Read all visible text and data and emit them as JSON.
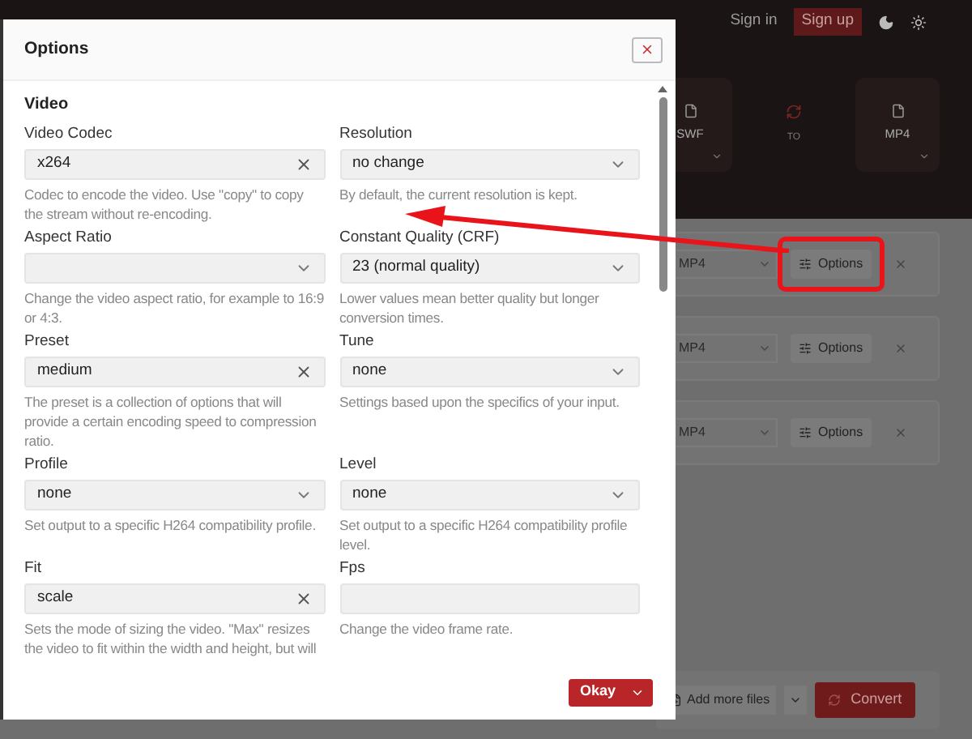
{
  "page": {
    "sign_in": "Sign in",
    "sign_up": "Sign up",
    "formats": [
      {
        "kind": "file",
        "label": "SWF"
      },
      {
        "kind": "convert",
        "label": "TO"
      },
      {
        "kind": "file",
        "label": "MP4"
      }
    ],
    "rows": [
      {
        "format": "MP4",
        "options": "Options",
        "highlighted": true
      },
      {
        "format": "MP4",
        "options": "Options",
        "highlighted": false
      },
      {
        "format": "MP4",
        "options": "Options",
        "highlighted": false
      }
    ],
    "add_more": "Add more files",
    "convert": "Convert"
  },
  "dialog": {
    "title": "Options",
    "section": "Video",
    "fields": [
      {
        "label": "Video Codec",
        "kind": "clearable",
        "value": "x264",
        "help": "Codec to encode the video. Use \"copy\" to copy the stream without re-encoding."
      },
      {
        "label": "Resolution",
        "kind": "select",
        "value": "no change",
        "help": "By default, the current resolution is kept."
      },
      {
        "label": "Aspect Ratio",
        "kind": "select",
        "help": "Change the video aspect ratio, for example to 16:9 or 4:3."
      },
      {
        "label": "Constant Quality (CRF)",
        "kind": "select",
        "value": "23 (normal quality)",
        "help": "Lower values mean better quality but longer conversion times."
      },
      {
        "label": "Preset",
        "kind": "clearable",
        "value": "medium",
        "help": "The preset is a collection of options that will provide a certain encoding speed to compression ratio."
      },
      {
        "label": "Tune",
        "kind": "select",
        "value": "none",
        "help": "Settings based upon the specifics of your input."
      },
      {
        "label": "Profile",
        "kind": "select",
        "value": "none",
        "help": "Set output to a specific H264 compatibility profile."
      },
      {
        "label": "Level",
        "kind": "select",
        "value": "none",
        "help": "Set output to a specific H264 compatibility profile level."
      },
      {
        "label": "Fit",
        "kind": "clearable",
        "value": "scale",
        "help": "Sets the mode of sizing the video. \"Max\" resizes the video to fit within the width and height, but will"
      },
      {
        "label": "Fps",
        "kind": "text",
        "help": "Change the video frame rate."
      }
    ],
    "ok": "Okay"
  }
}
